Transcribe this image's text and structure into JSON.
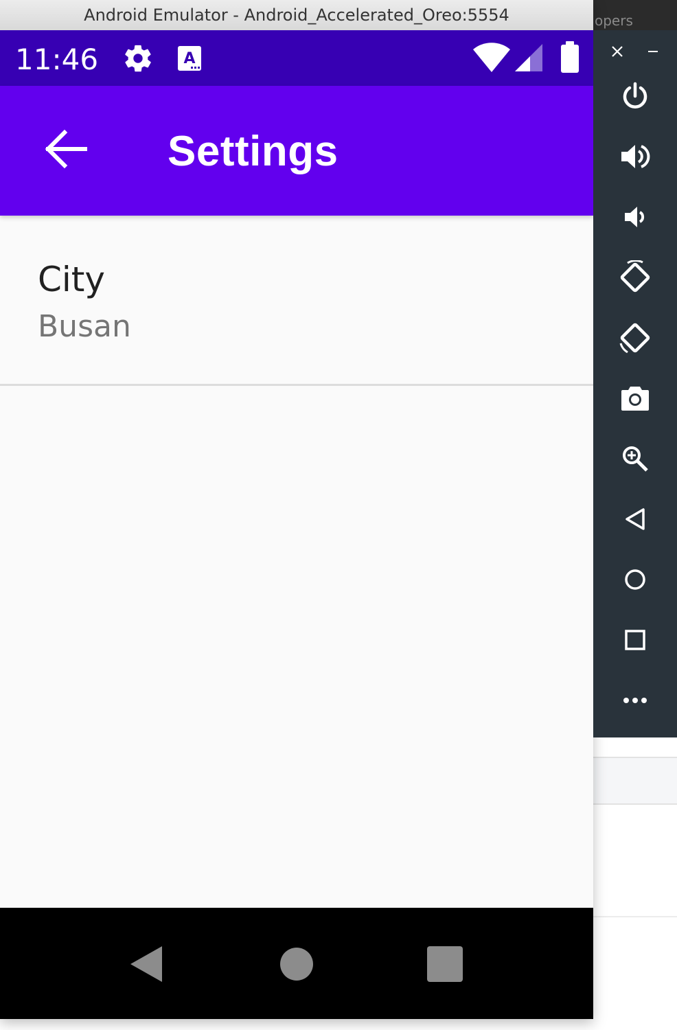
{
  "window": {
    "title": "Android Emulator - Android_Accelerated_Oreo:5554",
    "background_peek_text": "opers"
  },
  "status_bar": {
    "time": "11:46",
    "icons": [
      "settings-gear-icon",
      "keyboard-a-icon",
      "wifi-icon",
      "cell-signal-icon",
      "battery-icon"
    ],
    "color": "#3700b3"
  },
  "app_bar": {
    "title": "Settings",
    "back_icon": "arrow-back-icon",
    "color": "#6200ee"
  },
  "preferences": [
    {
      "title": "City",
      "summary": "Busan"
    }
  ],
  "nav_bar": {
    "buttons": [
      "back-triangle-icon",
      "home-circle-icon",
      "recents-square-icon"
    ]
  },
  "toolbar": {
    "buttons": [
      "close-icon",
      "minimize-icon",
      "power-icon",
      "volume-up-icon",
      "volume-down-icon",
      "rotate-left-icon",
      "rotate-right-icon",
      "camera-icon",
      "zoom-icon",
      "back-icon",
      "home-icon",
      "overview-icon",
      "more-icon"
    ]
  }
}
